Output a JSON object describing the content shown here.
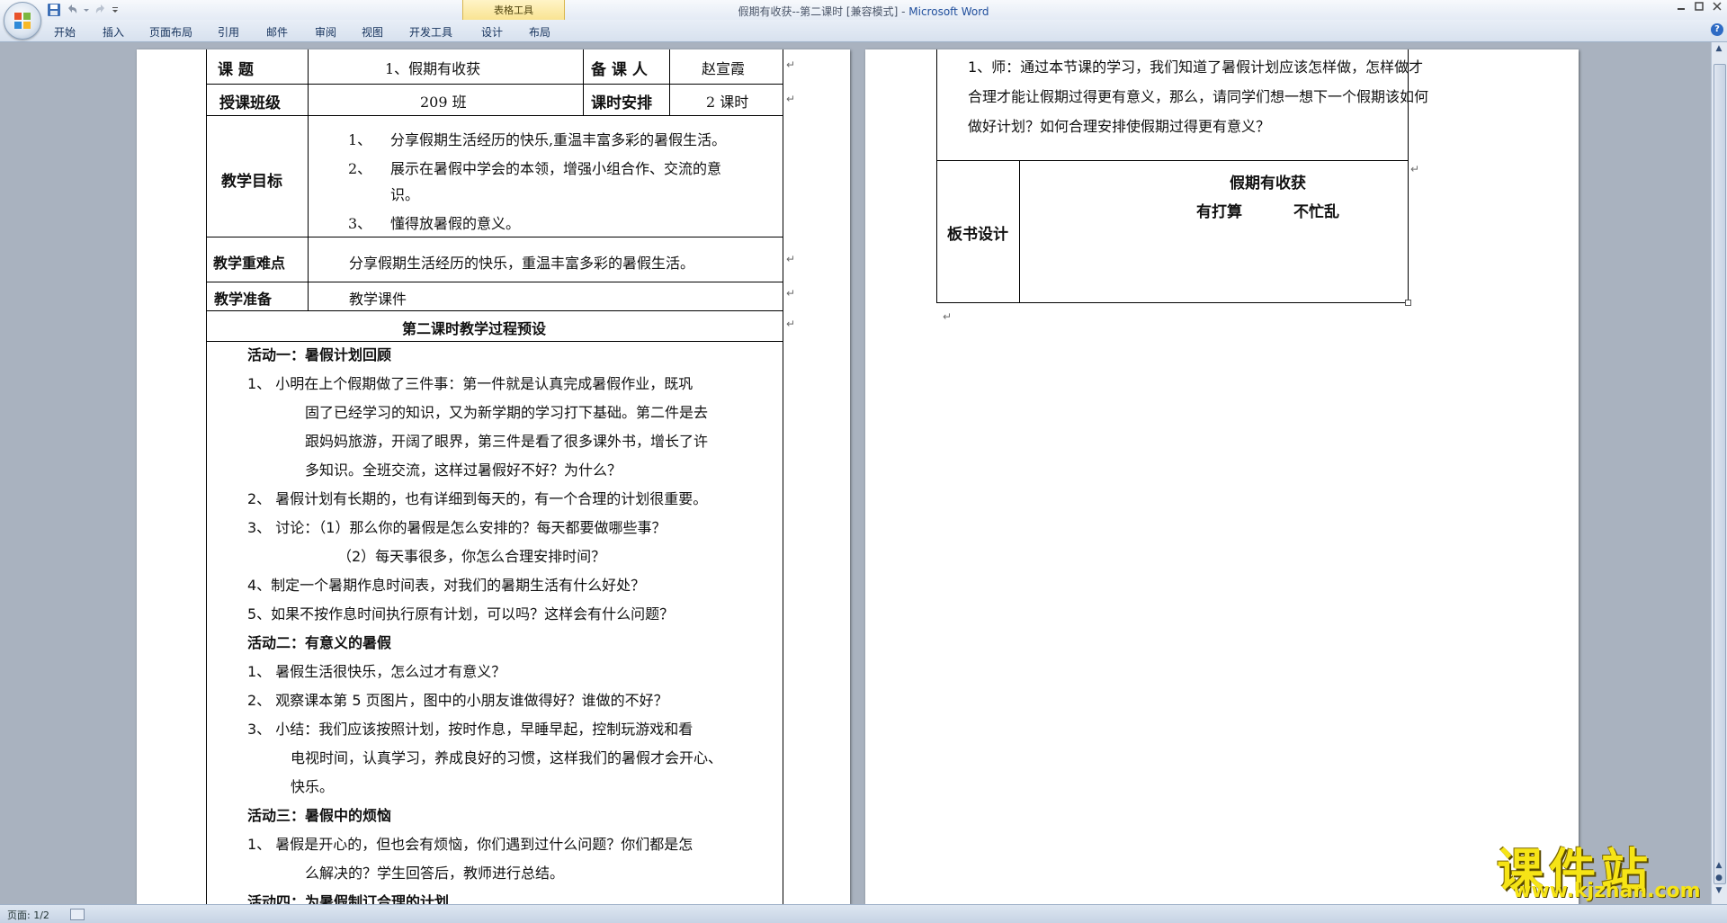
{
  "window": {
    "title_doc": "假期有收获--第二课时 [兼容模式] - ",
    "title_app": "Microsoft Word",
    "contextual_group": "表格工具"
  },
  "tabs": [
    "开始",
    "插入",
    "页面布局",
    "引用",
    "邮件",
    "审阅",
    "视图",
    "开发工具",
    "设计",
    "布局"
  ],
  "status": {
    "page": "页面: 1/2"
  },
  "watermark": {
    "cn": "课件站",
    "url": "www.kjzhan.com"
  },
  "page1": {
    "label_topic": "课      题",
    "topic": "1、假期有收获",
    "label_preparer": "备 课 人",
    "preparer": "赵宣霞",
    "label_class": "授课班级",
    "class": "209 班",
    "label_hours": "课时安排",
    "hours": "2 课时",
    "label_goals": "教学目标",
    "goals": [
      {
        "num": "1、",
        "text": "分享假期生活经历的快乐,重温丰富多彩的暑假生活。"
      },
      {
        "num": "2、",
        "text": "展示在暑假中学会的本领，增强小组合作、交流的意"
      },
      {
        "num": "",
        "text": "识。"
      },
      {
        "num": "3、",
        "text": "懂得放暑假的意义。"
      }
    ],
    "label_key": "教学重难点",
    "key": "分享假期生活经历的快乐，重温丰富多彩的暑假生活。",
    "label_prep": "教学准备",
    "prep": "教学课件",
    "process_title": "第二课时教学过程预设",
    "lines": [
      {
        "text": "活动一：暑假计划回顾",
        "style": "head",
        "indent": 46
      },
      {
        "text": "1、      小明在上个假期做了三件事：第一件就是认真完成暑假作业，既巩",
        "style": "normal",
        "indent": 46
      },
      {
        "text": "固了已经学习的知识，又为新学期的学习打下基础。第二件是去",
        "style": "normal",
        "indent": 110
      },
      {
        "text": "跟妈妈旅游，开阔了眼界，第三件是看了很多课外书，增长了许",
        "style": "normal",
        "indent": 110
      },
      {
        "text": "多知识。全班交流，这样过暑假好不好？为什么？",
        "style": "normal",
        "indent": 110
      },
      {
        "text": "2、      暑假计划有长期的，也有详细到每天的，有一个合理的计划很重要。",
        "style": "normal",
        "indent": 46
      },
      {
        "text": "3、      讨论：（1）那么你的暑假是怎么安排的？每天都要做哪些事？",
        "style": "normal",
        "indent": 46
      },
      {
        "text": "（2）每天事很多，你怎么合理安排时间？",
        "style": "normal",
        "indent": 146
      },
      {
        "text": "4、制定一个暑期作息时间表，对我们的暑期生活有什么好处？",
        "style": "normal",
        "indent": 46
      },
      {
        "text": "5、如果不按作息时间执行原有计划，可以吗？这样会有什么问题？",
        "style": "normal",
        "indent": 46
      },
      {
        "text": "活动二：有意义的暑假",
        "style": "head",
        "indent": 46
      },
      {
        "text": "1、      暑假生活很快乐，怎么过才有意义？",
        "style": "normal",
        "indent": 46
      },
      {
        "text": "2、      观察课本第 5 页图片，图中的小朋友谁做得好？谁做的不好？",
        "style": "normal",
        "indent": 46
      },
      {
        "text": "3、      小结：我们应该按照计划，按时作息，早睡早起，控制玩游戏和看",
        "style": "normal",
        "indent": 46
      },
      {
        "text": "电视时间，认真学习，养成良好的习惯，这样我们的暑假才会开心、",
        "style": "normal",
        "indent": 94
      },
      {
        "text": "快乐。",
        "style": "normal",
        "indent": 94
      },
      {
        "text": "活动三：暑假中的烦恼",
        "style": "head",
        "indent": 46
      },
      {
        "text": "1、      暑假是开心的，但也会有烦恼，你们遇到过什么问题？你们都是怎",
        "style": "normal",
        "indent": 46
      },
      {
        "text": "么解决的？学生回答后，教师进行总结。",
        "style": "normal",
        "indent": 110
      },
      {
        "text": "活动四：为暑假制订合理的计划",
        "style": "head",
        "indent": 46
      }
    ]
  },
  "page2": {
    "lines": [
      "1、师：通过本节课的学习，我们知道了暑假计划应该怎样做，怎样做才",
      "合理才能让假期过得更有意义，那么，请同学们想一想下一个假期该如何",
      "做好计划？如何合理安排使假期过得更有意义？"
    ],
    "board_label": "板书设计",
    "board_title": "假期有收获",
    "board_sub1": "有打算",
    "board_sub2": "不忙乱"
  }
}
